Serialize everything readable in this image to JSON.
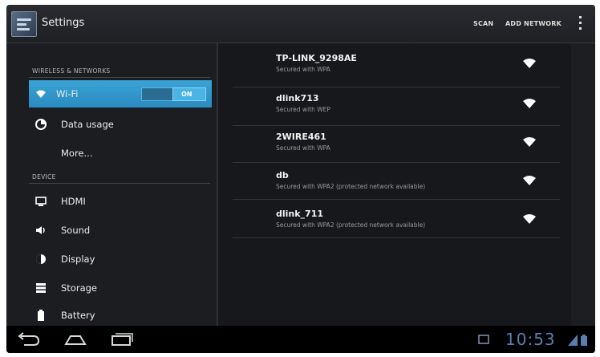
{
  "actionbar": {
    "title": "Settings",
    "actions": [
      "SCAN",
      "ADD NETWORK"
    ],
    "icon": "settings-icon",
    "overflow_icon": "overflow-menu-icon"
  },
  "sidebar": {
    "sections": [
      {
        "header": "WIRELESS & NETWORKS",
        "items": [
          {
            "label": "Wi-Fi",
            "icon": "wifi-icon",
            "selected": true,
            "toggle": "ON"
          },
          {
            "label": "Data usage",
            "icon": "data-usage-icon"
          },
          {
            "label": "More...",
            "icon": ""
          }
        ]
      },
      {
        "header": "DEVICE",
        "items": [
          {
            "label": "HDMI",
            "icon": "hdmi-icon"
          },
          {
            "label": "Sound",
            "icon": "sound-icon"
          },
          {
            "label": "Display",
            "icon": "display-icon"
          },
          {
            "label": "Storage",
            "icon": "storage-icon"
          },
          {
            "label": "Battery",
            "icon": "battery-icon"
          }
        ]
      }
    ]
  },
  "networks": [
    {
      "ssid": "TP-LINK_9298AE",
      "security": "Secured with WPA"
    },
    {
      "ssid": "dlink713",
      "security": "Secured with WEP"
    },
    {
      "ssid": "2WIRE461",
      "security": "Secured with WPA"
    },
    {
      "ssid": "db",
      "security": "Secured with WPA2 (protected network available)"
    },
    {
      "ssid": "dlink_711",
      "security": "Secured with WPA2 (protected network available)"
    }
  ],
  "systembar": {
    "time": "10:53",
    "nav_icons": [
      "back-icon",
      "home-icon",
      "recent-apps-icon"
    ],
    "status_icons": [
      "screenshot-icon",
      "signal-status-icon",
      "battery-status-icon"
    ]
  },
  "colors": {
    "accent": "#33B5E5",
    "background": "#15161A",
    "clock": "#5A7FB0"
  }
}
